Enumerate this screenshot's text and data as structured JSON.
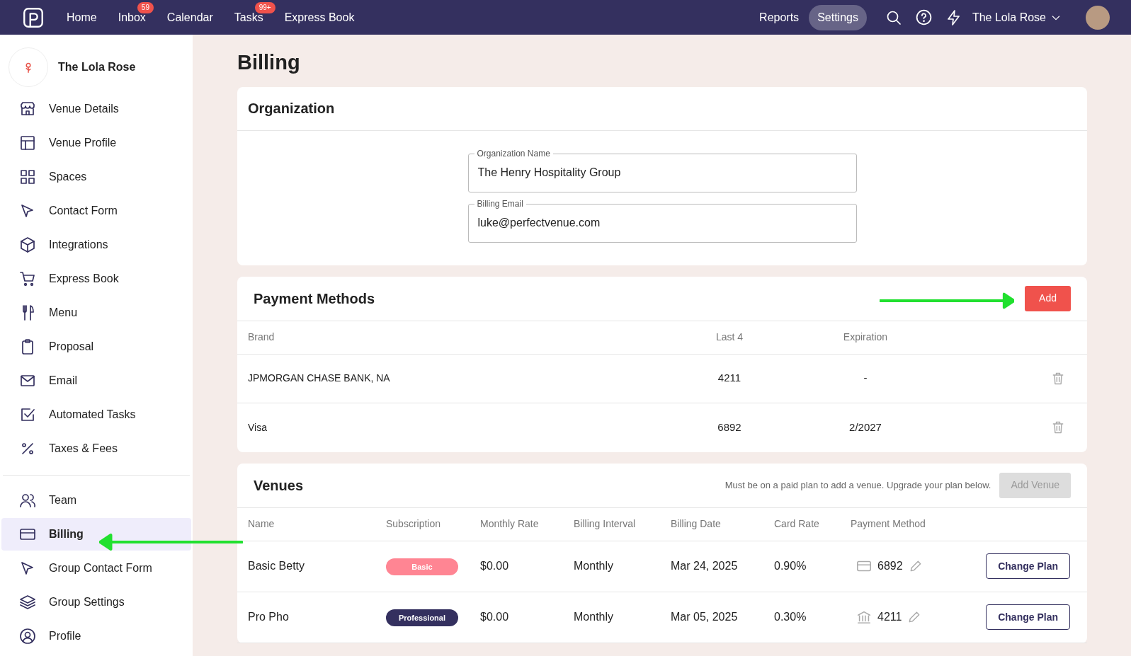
{
  "topbar": {
    "nav": [
      {
        "label": "Home"
      },
      {
        "label": "Inbox",
        "badge": "59"
      },
      {
        "label": "Calendar"
      },
      {
        "label": "Tasks",
        "badge": "99+"
      },
      {
        "label": "Express Book"
      }
    ],
    "right": [
      {
        "label": "Reports",
        "selected": false
      },
      {
        "label": "Settings",
        "selected": true
      }
    ],
    "account": "The Lola Rose"
  },
  "sidebar": {
    "venue_name": "The Lola Rose",
    "groups": [
      [
        {
          "label": "Venue Details",
          "selected": false
        },
        {
          "label": "Venue Profile",
          "selected": false
        },
        {
          "label": "Spaces",
          "selected": false
        },
        {
          "label": "Contact Form",
          "selected": false
        },
        {
          "label": "Integrations",
          "selected": false
        },
        {
          "label": "Express Book",
          "selected": false
        },
        {
          "label": "Menu",
          "selected": false
        },
        {
          "label": "Proposal",
          "selected": false
        },
        {
          "label": "Email",
          "selected": false
        },
        {
          "label": "Automated Tasks",
          "selected": false
        },
        {
          "label": "Taxes & Fees",
          "selected": false
        }
      ],
      [
        {
          "label": "Team",
          "selected": false
        },
        {
          "label": "Billing",
          "selected": true
        },
        {
          "label": "Group Contact Form",
          "selected": false
        },
        {
          "label": "Group Settings",
          "selected": false
        },
        {
          "label": "Profile",
          "selected": false
        }
      ]
    ]
  },
  "page_title": "Billing",
  "organization": {
    "title": "Organization",
    "fields": [
      {
        "label": "Organization Name",
        "value": "The Henry Hospitality Group"
      },
      {
        "label": "Billing Email",
        "value": "luke@perfectvenue.com"
      }
    ]
  },
  "payment_methods": {
    "title": "Payment Methods",
    "add_button": "Add",
    "columns": [
      "Brand",
      "Last 4",
      "Expiration"
    ],
    "rows": [
      {
        "brand": "JPMORGAN CHASE BANK, NA",
        "last4": "4211",
        "expiration": "-"
      },
      {
        "brand": "Visa",
        "last4": "6892",
        "expiration": "2/2027"
      }
    ]
  },
  "venues": {
    "title": "Venues",
    "note": "Must be on a paid plan to add a venue. Upgrade your plan below.",
    "add_button": "Add Venue",
    "add_disabled": true,
    "columns": [
      "Name",
      "Subscription",
      "Monthly Rate",
      "Billing Interval",
      "Billing Date",
      "Card Rate",
      "Payment Method"
    ],
    "rows": [
      {
        "name": "Basic Betty",
        "subscription": {
          "label": "Basic",
          "kind": "basic"
        },
        "rate": "$0.00",
        "interval": "Monthly",
        "date": "Mar 24, 2025",
        "card_rate": "0.90%",
        "payment_method": {
          "kind": "card",
          "last4": "6892"
        },
        "button": "Change Plan"
      },
      {
        "name": "Pro Pho",
        "subscription": {
          "label": "Professional",
          "kind": "professional"
        },
        "rate": "$0.00",
        "interval": "Monthly",
        "date": "Mar 05, 2025",
        "card_rate": "0.30%",
        "payment_method": {
          "kind": "bank",
          "last4": "4211"
        },
        "button": "Change Plan"
      }
    ]
  }
}
